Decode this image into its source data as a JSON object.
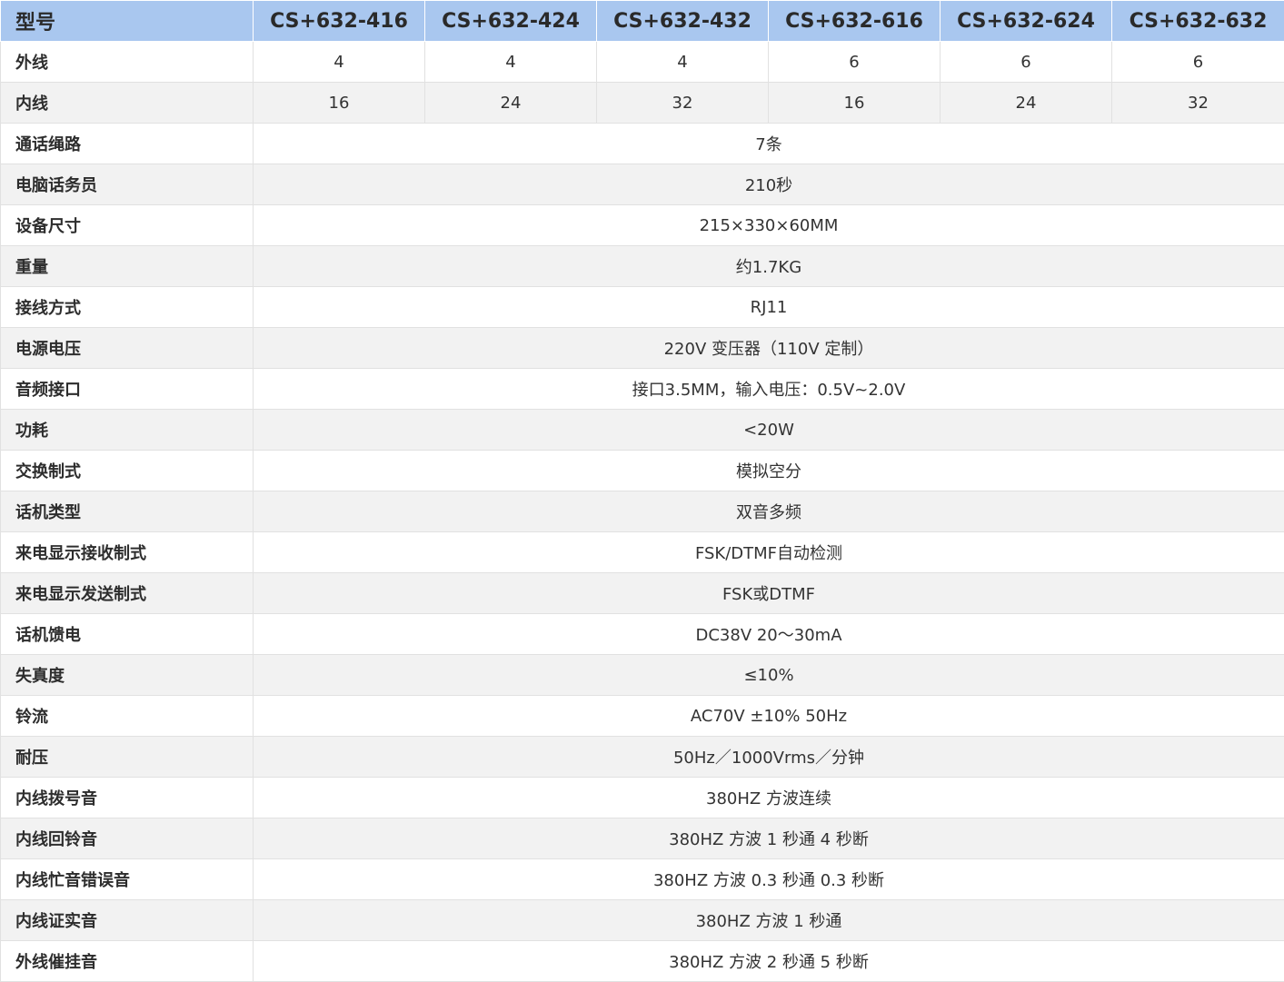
{
  "header": {
    "label": "型号",
    "models": [
      "CS+632-416",
      "CS+632-424",
      "CS+632-432",
      "CS+632-616",
      "CS+632-624",
      "CS+632-632"
    ]
  },
  "rows_per_model": [
    {
      "label": "外线",
      "values": [
        "4",
        "4",
        "4",
        "6",
        "6",
        "6"
      ]
    },
    {
      "label": "内线",
      "values": [
        "16",
        "24",
        "32",
        "16",
        "24",
        "32"
      ]
    }
  ],
  "rows_common": [
    {
      "label": "通话绳路",
      "value": "7条"
    },
    {
      "label": "电脑话务员",
      "value": "210秒"
    },
    {
      "label": "设备尺寸",
      "value": "215×330×60MM"
    },
    {
      "label": "重量",
      "value": "约1.7KG"
    },
    {
      "label": "接线方式",
      "value": "RJ11"
    },
    {
      "label": "电源电压",
      "value": "220V 变压器（110V 定制）"
    },
    {
      "label": "音频接口",
      "value": "接口3.5MM，输入电压：0.5V~2.0V"
    },
    {
      "label": "功耗",
      "value": "<20W"
    },
    {
      "label": "交换制式",
      "value": "模拟空分"
    },
    {
      "label": "话机类型",
      "value": "双音多频"
    },
    {
      "label": "来电显示接收制式",
      "value": "FSK/DTMF自动检测"
    },
    {
      "label": "来电显示发送制式",
      "value": "FSK或DTMF"
    },
    {
      "label": "话机馈电",
      "value": "DC38V 20～30mA"
    },
    {
      "label": "失真度",
      "value": "≤10%"
    },
    {
      "label": "铃流",
      "value": "AC70V  ±10%  50Hz"
    },
    {
      "label": "耐压",
      "value": "50Hz／1000Vrms／分钟"
    },
    {
      "label": "内线拨号音",
      "value": "380HZ 方波连续"
    },
    {
      "label": "内线回铃音",
      "value": "380HZ 方波 1 秒通 4 秒断"
    },
    {
      "label": "内线忙音错误音",
      "value": "380HZ 方波 0.3 秒通 0.3 秒断"
    },
    {
      "label": "内线证实音",
      "value": "380HZ 方波 1 秒通"
    },
    {
      "label": "外线催挂音",
      "value": "380HZ 方波 2 秒通 5 秒断"
    }
  ],
  "colors": {
    "header_bg": "#a9c7ef",
    "row_alt_bg": "#f2f2f2",
    "border": "#e1e1e1"
  }
}
